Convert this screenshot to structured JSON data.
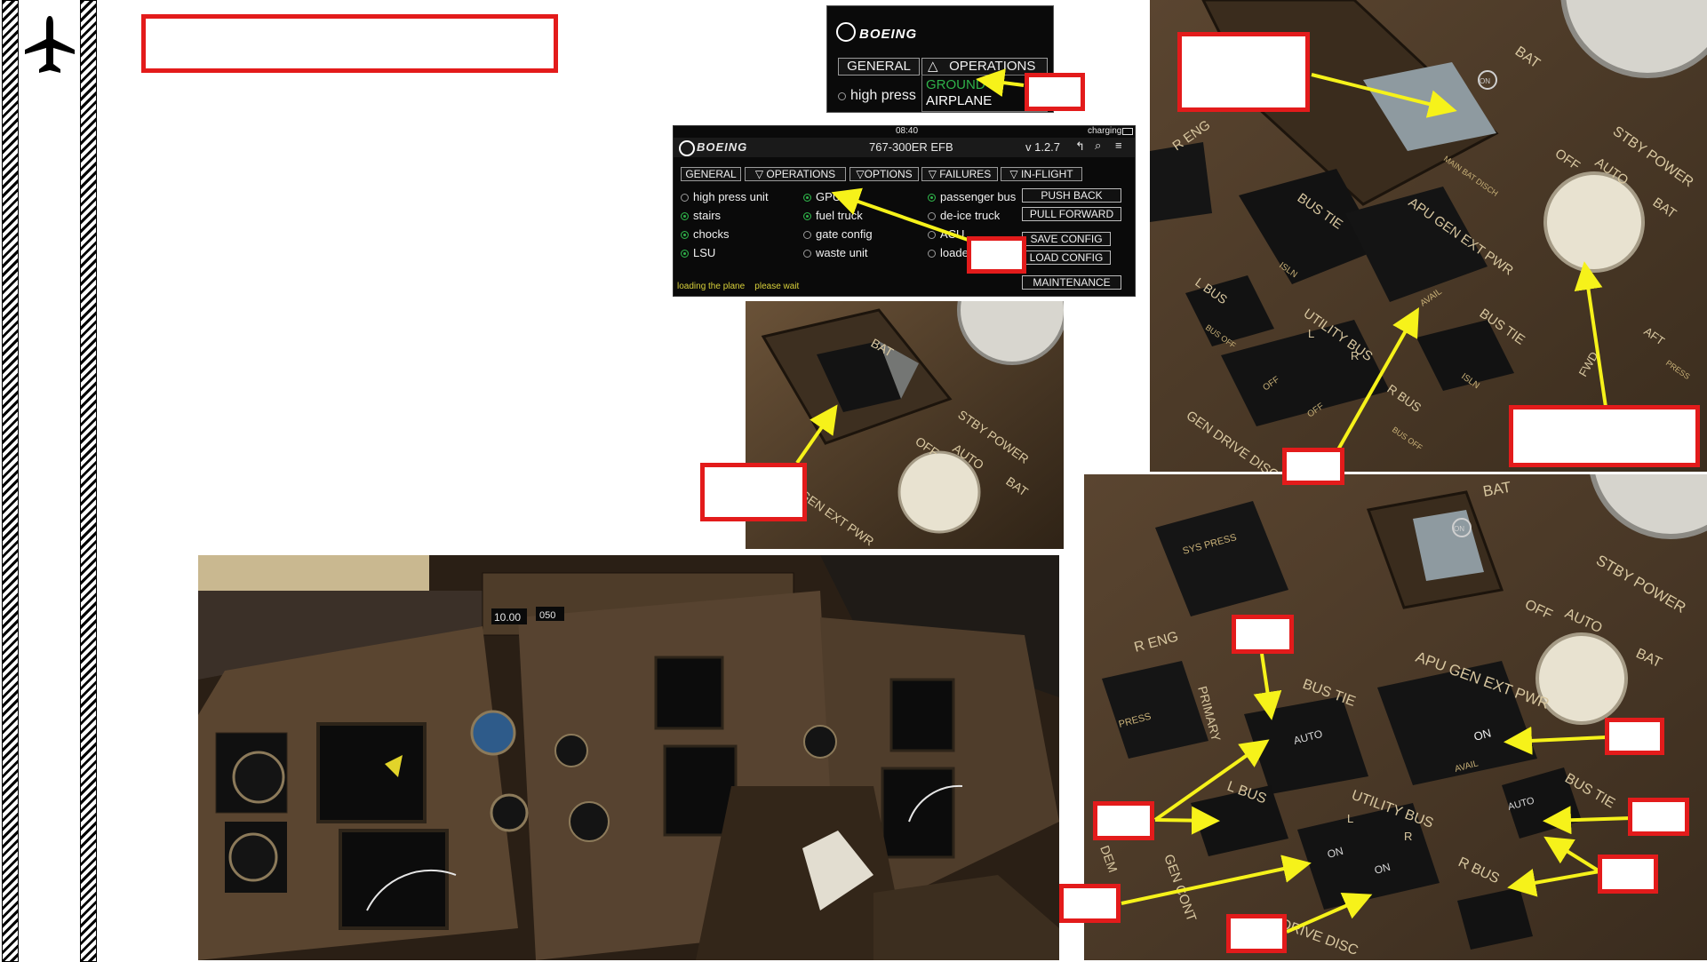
{
  "efb_small": {
    "brand": "BOEING",
    "tab_general": "GENERAL",
    "tab_operations": "OPERATIONS",
    "tab_operations_arrow": "△",
    "opt_high_press": "high press",
    "menu_ground": "GROUND",
    "menu_airplane": "AIRPLANE"
  },
  "efb_main": {
    "time": "08:40",
    "charging": "charging",
    "brand": "BOEING",
    "title": "767-300ER EFB",
    "version": "v 1.2.7",
    "tabs": [
      "GENERAL",
      "▽  OPERATIONS",
      "▽OPTIONS",
      "▽  FAILURES",
      "▽  IN-FLIGHT"
    ],
    "col1": [
      {
        "label": "high press unit",
        "on": false
      },
      {
        "label": "stairs",
        "on": true
      },
      {
        "label": "chocks",
        "on": true
      },
      {
        "label": "LSU",
        "on": true
      }
    ],
    "col2": [
      {
        "label": "GPU",
        "on": true
      },
      {
        "label": "fuel truck",
        "on": true
      },
      {
        "label": "gate config",
        "on": false
      },
      {
        "label": "waste unit",
        "on": false
      }
    ],
    "col3": [
      {
        "label": "passenger bus",
        "on": true
      },
      {
        "label": "de-ice truck",
        "on": false
      },
      {
        "label": "ACU",
        "on": false
      },
      {
        "label": "loade",
        "on": false
      }
    ],
    "buttons": {
      "push_back": "PUSH BACK",
      "pull_forward": "PULL FORWARD",
      "save_config": "SAVE CONFIG",
      "load_config": "LOAD CONFIG",
      "maintenance": "MAINTENANCE"
    },
    "status": "loading the plane    please wait"
  },
  "overhead_small": {
    "bat": "BAT",
    "stby_power": "STBY POWER",
    "off": "OFF",
    "auto": "AUTO",
    "bat_knob": "BAT",
    "gen_ext_pwr": "GEN EXT PWR"
  },
  "overhead_top_right": {
    "bat": "BAT",
    "on": "ON",
    "main_bat_disch": "MAIN BAT DISCH",
    "stby_power": "STBY POWER",
    "off": "OFF",
    "auto": "AUTO",
    "bat_knob": "BAT",
    "r_eng": "R ENG",
    "bus_tie": "BUS TIE",
    "isln": "ISLN",
    "apu_gen_ext_pwr": "APU GEN EXT PWR",
    "avail": "AVAIL",
    "l_bus": "L BUS",
    "bus_off": "BUS OFF",
    "utility_bus": "UTILITY BUS",
    "l": "L",
    "r": "R",
    "off_l": "OFF",
    "off_r": "OFF",
    "bus_tie_r": "BUS TIE",
    "isln_r": "ISLN",
    "r_bus": "R BUS",
    "bus_off_r": "BUS OFF",
    "gen_drive_disc": "GEN DRIVE DISC",
    "aft": "AFT",
    "fwd": "FWD",
    "press": "PRESS"
  },
  "overhead_bottom_right": {
    "bat": "BAT",
    "on": "ON",
    "sys_press": "SYS PRESS",
    "stby_power": "STBY POWER",
    "off": "OFF",
    "auto": "AUTO",
    "bat_knob": "BAT",
    "r_eng": "R ENG",
    "press": "PRESS",
    "primary": "PRIMARY",
    "bus_tie": "BUS TIE",
    "auto_l": "AUTO",
    "apu_gen_ext_pwr": "APU GEN EXT PWR",
    "on_ext": "ON",
    "avail": "AVAIL",
    "l_bus": "L BUS",
    "utility_bus": "UTILITY BUS",
    "l": "L",
    "r": "R",
    "on_l": "ON",
    "on_r": "ON",
    "bus_tie_r": "BUS TIE",
    "auto_r": "AUTO",
    "r_bus": "R BUS",
    "gen_cont": "GEN CONT",
    "drive_disc": "DRIVE DISC",
    "dem": "DEM"
  },
  "cockpit": {
    "clock": "10.00",
    "hdg": "050"
  },
  "colors": {
    "callout_red": "#e31b1b",
    "arrow_yellow": "#f6f21a",
    "efb_green": "#2fb24a",
    "panel_brown": "#5a4530"
  },
  "icons": {
    "sidebar": "airplane-icon"
  }
}
